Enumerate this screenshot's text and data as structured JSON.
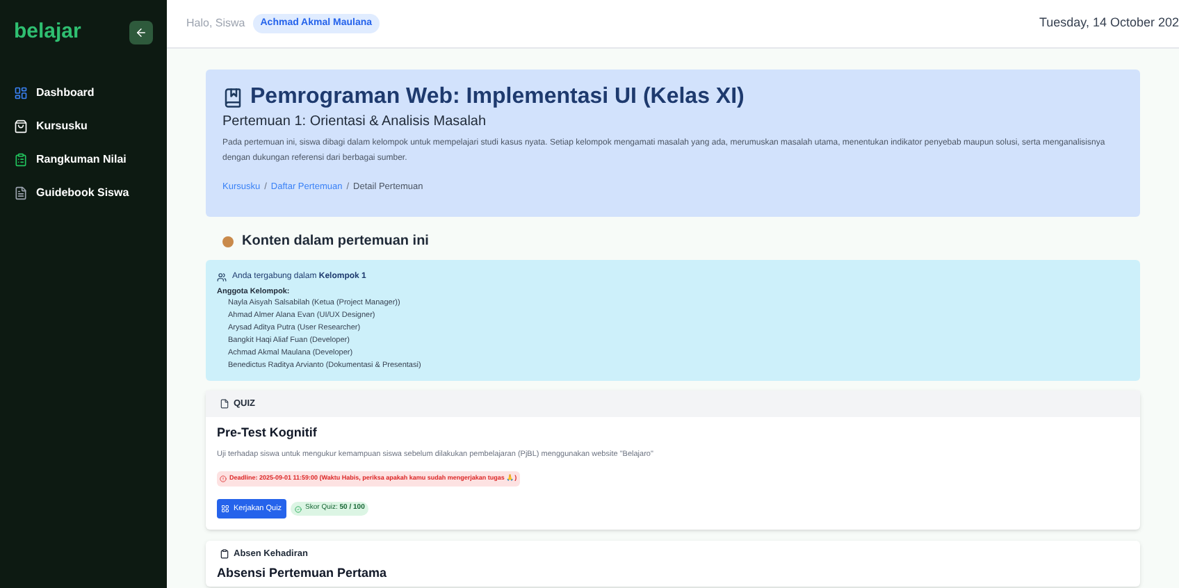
{
  "sidebar": {
    "logo": "belajar",
    "items": [
      {
        "label": "Dashboard",
        "kind": "dashboard"
      },
      {
        "label": "Kursusku",
        "kind": "courses"
      },
      {
        "label": "Rangkuman Nilai",
        "kind": "grades"
      },
      {
        "label": "Guidebook Siswa",
        "kind": "guide"
      }
    ]
  },
  "header": {
    "greeting": "Halo, Siswa",
    "user": "Achmad Akmal Maulana",
    "date": "Tuesday, 14 October 202"
  },
  "course": {
    "title": "Pemrograman Web: Implementasi UI (Kelas XI)",
    "subtitle": "Pertemuan 1: Orientasi & Analisis Masalah",
    "description": "Pada pertemuan ini, siswa dibagi dalam kelompok untuk mempelajari studi kasus nyata. Setiap kelompok mengamati masalah yang ada, merumuskan masalah utama, menentukan indikator penyebab maupun solusi, serta menganalisisnya dengan dukungan referensi dari berbagai sumber.",
    "breadcrumbs": [
      "Kursusku",
      "Daftar Pertemuan",
      "Detail Pertemuan"
    ],
    "breadcrumb_separator": "/"
  },
  "content_heading": "Konten dalam pertemuan ini",
  "group": {
    "joined": "Anda tergabung dalam **Kelompok 1**",
    "members_label": "Anggota Kelompok:",
    "members": [
      "Nayla Aisyah Salsabilah (Ketua (Project Manager))",
      "Ahmad Almer Alana Evan (UI/UX Designer)",
      "Arysad Aditya Putra (User Researcher)",
      "Bangkit Haqi Aliaf Fuan (Developer)",
      "Achmad Akmal Maulana (Developer)",
      "Benedictus Raditya Arvianto (Dokumentasi & Presentasi)"
    ]
  },
  "quiz": {
    "section": "QUIZ",
    "title": "Pre-Test Kognitif",
    "description": "Uji terhadap siswa untuk mengukur kemampuan siswa sebelum dilakukan pembelajaran (PjBL) menggunakan website \"Belajaro\"",
    "deadline": "Deadline: 2025-09-01 11:59:00 (Waktu Habis, periksa apakah kamu sudah mengerjakan tugas 🙏)",
    "button": "Kerjakan Quiz",
    "score": "Skor Quiz: **50 / 100**"
  },
  "attendance": {
    "section": "Absen Kehadiran",
    "title": "Absensi Pertemuan Pertama"
  }
}
